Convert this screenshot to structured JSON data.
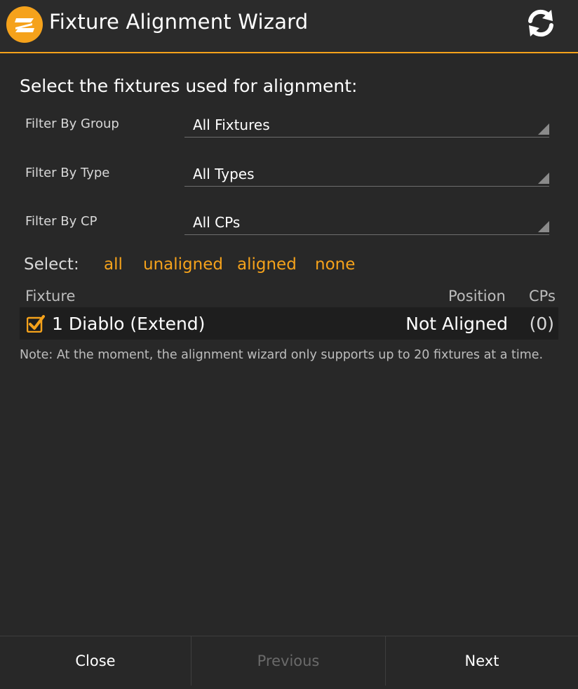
{
  "window": {
    "title": "Fixture Alignment Wizard",
    "logo_icon": "app-logo-icon",
    "refresh_icon": "refresh-icon",
    "accent_color": "#f5a21b"
  },
  "main": {
    "heading": "Select the fixtures used for alignment:",
    "filters": [
      {
        "label": "Filter By Group",
        "value": "All Fixtures"
      },
      {
        "label": "Filter By Type",
        "value": "All Types"
      },
      {
        "label": "Filter By CP",
        "value": "All CPs"
      }
    ],
    "select": {
      "label": "Select:",
      "options": [
        "all",
        "unaligned",
        "aligned",
        "none"
      ]
    },
    "table": {
      "headers": {
        "fixture": "Fixture",
        "position": "Position",
        "cps": "CPs"
      },
      "rows": [
        {
          "checked": true,
          "name": "1 Diablo (Extend)",
          "position": "Not Aligned",
          "cps": "(0)"
        }
      ]
    },
    "note": "Note: At the moment, the alignment wizard only supports up to 20 fixtures at a time."
  },
  "footer": {
    "close_label": "Close",
    "previous_label": "Previous",
    "previous_enabled": false,
    "next_label": "Next"
  }
}
